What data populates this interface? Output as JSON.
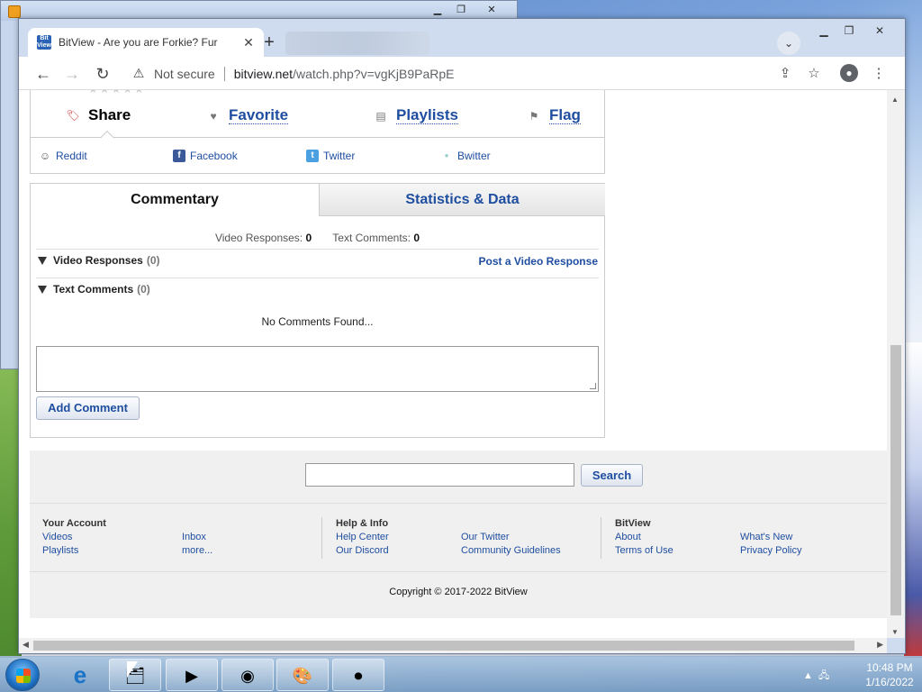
{
  "browser": {
    "tab_title": "BitView - Are you are Forkie? Fur",
    "tab_favicon": "Bit\nView",
    "not_secure": "Not secure",
    "url_host": "bitview.net",
    "url_path": "/watch.php?v=vgKjB9PaRpE"
  },
  "actions": {
    "share": "Share",
    "favorite": "Favorite",
    "playlists": "Playlists",
    "flag": "Flag"
  },
  "social": [
    "Reddit",
    "Facebook",
    "Twitter",
    "Bwitter"
  ],
  "tabs": {
    "commentary": "Commentary",
    "stats": "Statistics & Data"
  },
  "counts": {
    "video_label": "Video Responses:",
    "video_value": "0",
    "text_label": "Text Comments:",
    "text_value": "0"
  },
  "sections": {
    "video_responses": "Video Responses",
    "video_responses_count": "(0)",
    "post_video_response": "Post a Video Response",
    "text_comments": "Text Comments",
    "text_comments_count": "(0)",
    "no_comments": "No Comments Found...",
    "add_comment": "Add Comment"
  },
  "footer": {
    "search_button": "Search",
    "your_account": "Your Account",
    "videos": "Videos",
    "inbox": "Inbox",
    "playlists": "Playlists",
    "more": "more...",
    "help_info": "Help & Info",
    "help_center": "Help Center",
    "our_twitter": "Our Twitter",
    "our_discord": "Our Discord",
    "community_guidelines": "Community Guidelines",
    "bitview": "BitView",
    "about": "About",
    "whats_new": "What's New",
    "terms": "Terms of Use",
    "privacy": "Privacy Policy",
    "copyright": "Copyright © 2017-2022 BitView"
  },
  "taskbar": {
    "time": "10:48 PM",
    "date": "1/16/2022"
  }
}
